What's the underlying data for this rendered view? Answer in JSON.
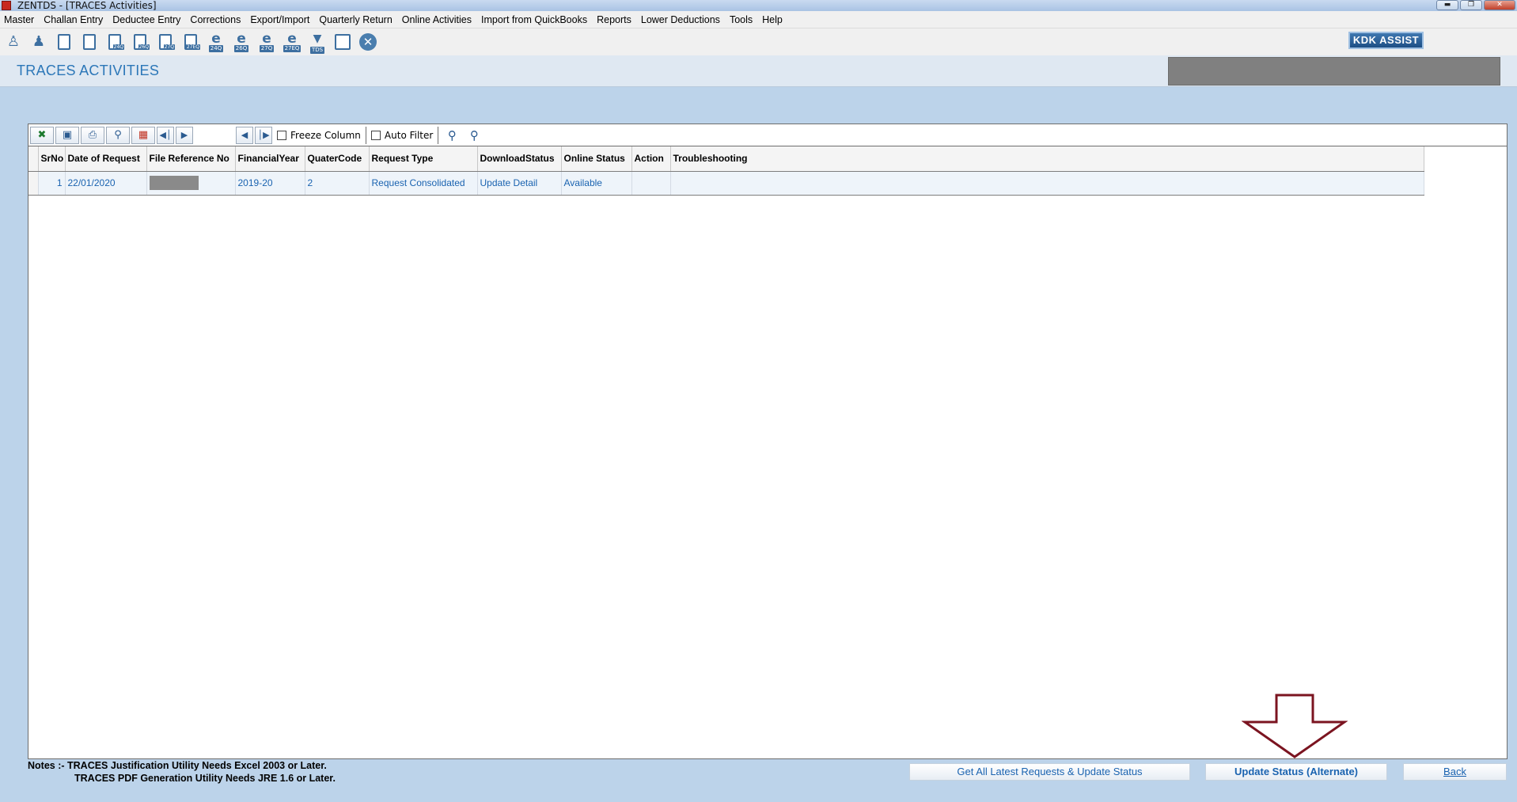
{
  "window": {
    "title": "ZENTDS - [TRACES Activities]",
    "controls": [
      "minimize",
      "restore",
      "close"
    ]
  },
  "menu": [
    "Master",
    "Challan Entry",
    "Deductee Entry",
    "Corrections",
    "Export/Import",
    "Quarterly Return",
    "Online Activities",
    "Import from QuickBooks",
    "Reports",
    "Lower Deductions",
    "Tools",
    "Help"
  ],
  "toolbar": {
    "icons": [
      {
        "name": "deductor-icon",
        "tag": ""
      },
      {
        "name": "deductee-icon",
        "tag": ""
      },
      {
        "name": "form-24q-icon",
        "tag": ""
      },
      {
        "name": "form-26q-icon",
        "tag": ""
      },
      {
        "name": "form-24q-doc-icon",
        "tag": "24Q"
      },
      {
        "name": "form-26q-doc-icon",
        "tag": "26Q"
      },
      {
        "name": "form-27q-doc-icon",
        "tag": "27Q"
      },
      {
        "name": "form-27eq-doc-icon",
        "tag": "27EQ"
      },
      {
        "name": "e-24q-icon",
        "tag": "24Q"
      },
      {
        "name": "e-26q-icon",
        "tag": "26Q"
      },
      {
        "name": "e-27q-icon",
        "tag": "27Q"
      },
      {
        "name": "e-27eq-icon",
        "tag": "27EQ"
      },
      {
        "name": "tds-icon",
        "tag": "TDS"
      },
      {
        "name": "pdf-report-icon",
        "tag": ""
      },
      {
        "name": "close-round-icon",
        "tag": ""
      }
    ],
    "kdk_assist": "KDK ASSIST"
  },
  "page": {
    "title": "TRACES ACTIVITIES"
  },
  "grid": {
    "toolbar": {
      "freeze_column": "Freeze Column",
      "auto_filter": "Auto Filter"
    },
    "columns": [
      "SrNo",
      "Date of Request",
      "File Reference No",
      "FinancialYear",
      "QuaterCode",
      "Request Type",
      "DownloadStatus",
      "Online Status",
      "Action",
      "Troubleshooting"
    ],
    "rows": [
      {
        "srno": "1",
        "date": "22/01/2020",
        "file_ref": "",
        "fy": "2019-20",
        "quarter": "2",
        "request_type": "Request Consolidated",
        "download_status": "Update Detail",
        "online_status": "Available",
        "action": "",
        "troubleshooting": ""
      }
    ]
  },
  "notes": {
    "line1": "Notes :- TRACES Justification Utility Needs Excel 2003 or Later.",
    "line2": "TRACES PDF Generation Utility Needs JRE 1.6 or Later."
  },
  "buttons": {
    "get_all": "Get All Latest Requests & Update Status",
    "update_alt": "Update Status (Alternate)",
    "back": "Back"
  },
  "colors": {
    "accent": "#2c77b8",
    "link": "#1a63b0",
    "background": "#bcd3ea",
    "arrow": "#7b1420"
  }
}
